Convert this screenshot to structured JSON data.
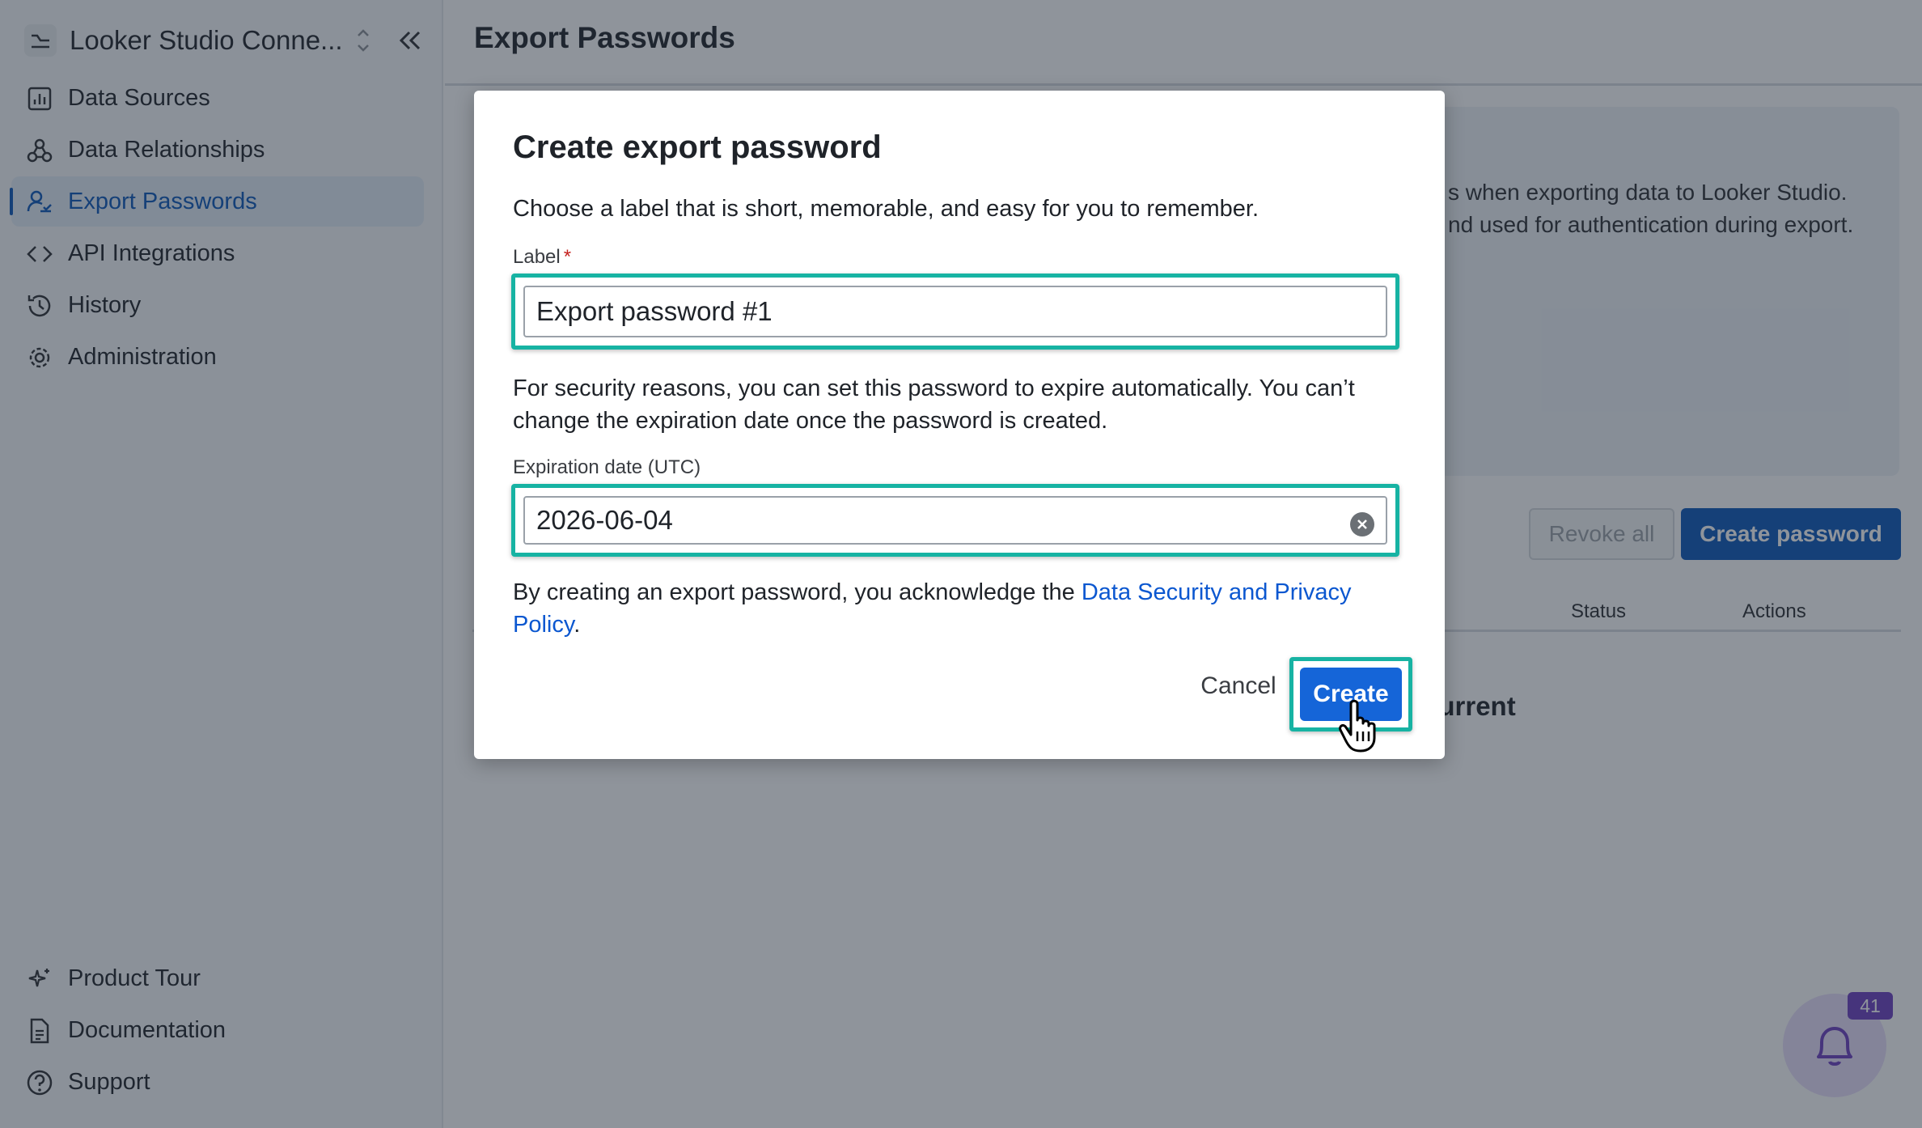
{
  "sidebar": {
    "workspace_name": "Looker Studio Conne...",
    "items": [
      {
        "label": "Data Sources",
        "icon": "bar-chart-icon"
      },
      {
        "label": "Data Relationships",
        "icon": "relationships-icon"
      },
      {
        "label": "Export Passwords",
        "icon": "user-key-icon",
        "active": true
      },
      {
        "label": "API Integrations",
        "icon": "code-icon"
      },
      {
        "label": "History",
        "icon": "history-icon"
      },
      {
        "label": "Administration",
        "icon": "gear-icon"
      }
    ],
    "footer_items": [
      {
        "label": "Product Tour",
        "icon": "sparkle-icon"
      },
      {
        "label": "Documentation",
        "icon": "document-icon"
      },
      {
        "label": "Support",
        "icon": "help-circle-icon"
      }
    ]
  },
  "header": {
    "title": "Export Passwords"
  },
  "info_panel": {
    "line1": "s when exporting data to Looker Studio.",
    "line2": "nd used for authentication during export."
  },
  "actions": {
    "revoke_all": "Revoke all",
    "create_password": "Create password"
  },
  "table": {
    "columns": [
      "Status",
      "Actions"
    ],
    "empty_text": "current"
  },
  "notifications": {
    "count": "41"
  },
  "modal": {
    "title": "Create export password",
    "intro": "Choose a label that is short, memorable, and easy for you to remember.",
    "label_field": {
      "label": "Label",
      "required_mark": "*",
      "value": "Export password #1"
    },
    "expiry_text_1": "For security reasons, you can set this password to expire automatically. You can’t",
    "expiry_text_2": "change the expiration date once the password is created.",
    "date_field": {
      "label": "Expiration date (UTC)",
      "value": "2026-06-04"
    },
    "ack_prefix": "By creating an export password, you acknowledge the ",
    "ack_link_1": "Data Security and Privacy",
    "ack_link_2": "Policy",
    "ack_suffix": ".",
    "cancel_label": "Cancel",
    "create_label": "Create"
  },
  "colors": {
    "accent": "#0b57b8",
    "primary_button": "#1565d8",
    "highlight": "#17b3a3",
    "badge": "#6d3fc0"
  }
}
